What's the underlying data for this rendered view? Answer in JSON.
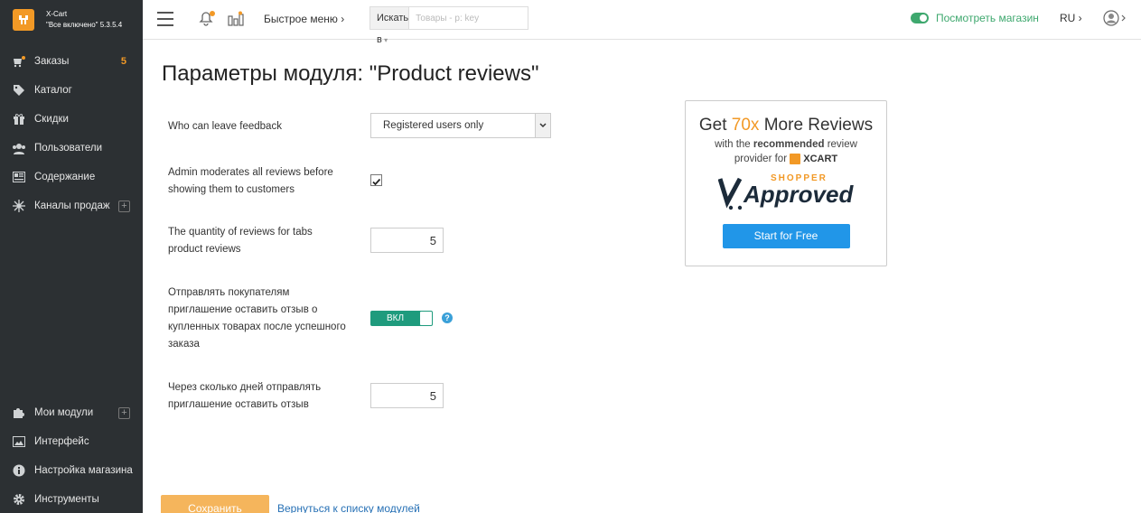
{
  "brand": {
    "name": "X-Cart",
    "edition": "\"Все включено\" 5.3.5.4"
  },
  "sidebar": {
    "items": [
      {
        "label": "Заказы",
        "badge": "5",
        "icon": "orders-icon"
      },
      {
        "label": "Каталог",
        "icon": "tag-icon"
      },
      {
        "label": "Скидки",
        "icon": "gift-icon"
      },
      {
        "label": "Пользователи",
        "icon": "users-icon"
      },
      {
        "label": "Содержание",
        "icon": "content-icon"
      },
      {
        "label": "Каналы продаж",
        "icon": "network-icon",
        "plus": "+"
      }
    ],
    "bottom_items": [
      {
        "label": "Мои модули",
        "icon": "puzzle-icon",
        "plus": "+"
      },
      {
        "label": "Интерфейс",
        "icon": "image-icon"
      },
      {
        "label": "Настройка магазина",
        "icon": "info-icon"
      },
      {
        "label": "Инструменты",
        "icon": "gear-icon"
      }
    ]
  },
  "topbar": {
    "quick_menu": "Быстрое меню",
    "search_scope": "Искать в",
    "search_placeholder": "Товары - р: key",
    "view_store": "Посмотреть магазин",
    "language": "RU"
  },
  "page": {
    "title": "Параметры модуля: \"Product reviews\""
  },
  "form": {
    "who_label": "Who can leave feedback",
    "who_value": "Registered users only",
    "moderate_label": "Admin moderates all reviews before showing them to customers",
    "moderate_checked": true,
    "qty_label": "The quantity of reviews for tabs product reviews",
    "qty_value": "5",
    "invite_label": "Отправлять покупателям приглашение оставить отзыв о купленных товарах после успешного заказа",
    "invite_toggle": "ВКЛ",
    "days_label": "Через сколько дней отправлять приглашение оставить отзыв",
    "days_value": "5"
  },
  "promo": {
    "title_pre": "Get ",
    "title_hl": "70x",
    "title_post": " More Reviews",
    "sub_pre": "with the ",
    "sub_bold": "recommended",
    "sub_post": " review",
    "sub_line2": "provider for",
    "xcart": "XCART",
    "logo_top": "SHOPPER",
    "logo_main": "Approved",
    "button": "Start for Free"
  },
  "actions": {
    "save": "Сохранить",
    "back": "Вернуться к списку модулей"
  },
  "colors": {
    "accent": "#f29926",
    "green": "#3ea86e",
    "teal": "#1f9b7d",
    "blue": "#2196e8",
    "sidebar_bg": "#2c3033"
  }
}
